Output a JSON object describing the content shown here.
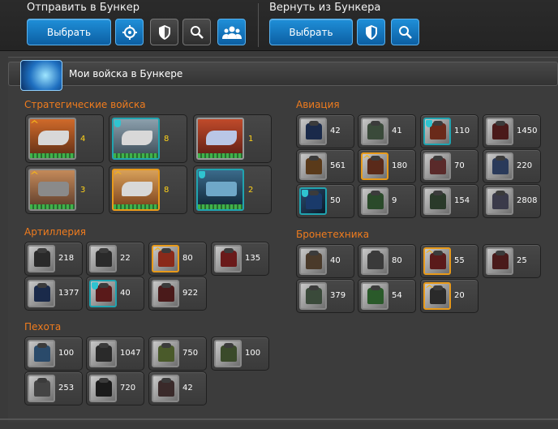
{
  "send": {
    "title": "Отправить в Бункер",
    "select_label": "Выбрать"
  },
  "return": {
    "title": "Вернуть из Бункера",
    "select_label": "Выбрать"
  },
  "panel": {
    "title": "Мои войска в Бункере"
  },
  "sections": {
    "strategic": {
      "title": "Стратегические войска",
      "counts": [
        "4",
        "8",
        "1",
        "3",
        "8",
        "2"
      ]
    },
    "artillery": {
      "title": "Артиллерия",
      "counts": [
        "218",
        "22",
        "80",
        "135",
        "1377",
        "40",
        "922"
      ]
    },
    "infantry": {
      "title": "Пехота",
      "counts": [
        "100",
        "1047",
        "750",
        "100",
        "253",
        "720",
        "42"
      ]
    },
    "aviation": {
      "title": "Авиация",
      "counts": [
        "42",
        "41",
        "110",
        "1450",
        "561",
        "180",
        "70",
        "220",
        "50",
        "9",
        "154",
        "2808"
      ]
    },
    "armor": {
      "title": "Бронетехника",
      "counts": [
        "40",
        "80",
        "55",
        "25",
        "379",
        "54",
        "20"
      ]
    }
  },
  "colors": {
    "accent_blue": "#1f8fd8",
    "section_title": "#f07c1e",
    "gold_border": "#e89a1a",
    "teal_border": "#20a4b0",
    "strategic_count": "#ffd21a"
  }
}
